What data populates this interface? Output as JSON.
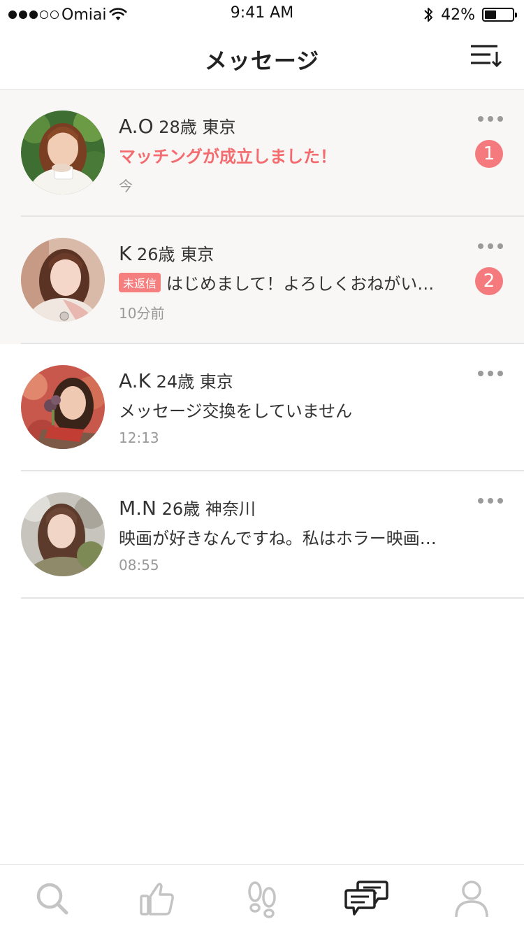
{
  "status_bar": {
    "carrier": "Omiai",
    "time": "9:41 AM",
    "battery": "42%",
    "battery_level": 0.42,
    "signal_bars": 3,
    "signal_total": 5
  },
  "header": {
    "title": "メッセージ",
    "sort_icon": "sort-down-icon"
  },
  "messages": [
    {
      "initials": "A.O",
      "age": "28歳",
      "location": "東京",
      "preview": "マッチングが成立しました！",
      "time": "今",
      "badge": "1",
      "unread": true
    },
    {
      "initials": "K",
      "age": "26歳",
      "location": "東京",
      "tag": "未返信",
      "preview": "はじめまして！よろしくおねがい…",
      "time": "10分前",
      "badge": "2",
      "unread": true
    },
    {
      "initials": "A.K",
      "age": "24歳",
      "location": "東京",
      "preview": "メッセージ交換をしていません",
      "time": "12:13",
      "unread": false
    },
    {
      "initials": "M.N",
      "age": "26歳",
      "location": "神奈川",
      "preview": "映画が好きなんですね。私はホラー映画…",
      "time": "08:55",
      "unread": false
    }
  ],
  "tabbar": {
    "items": [
      "search-icon",
      "like-icon",
      "footprints-icon",
      "messages-icon",
      "profile-icon"
    ],
    "active": "messages-icon"
  },
  "colors": {
    "accent": "#f36b6f",
    "badge": "#f47a7d",
    "unread_bg": "#f8f7f5"
  }
}
